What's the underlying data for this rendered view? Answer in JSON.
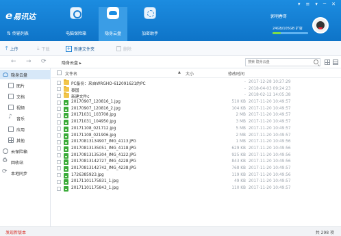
{
  "header": {
    "logo_mark": "e",
    "logo_text": "易讯达",
    "transfer_list": "传输列表",
    "tabs": [
      {
        "label": "电脑保险箱",
        "icon": "safebox-icon"
      },
      {
        "label": "隐身云盘",
        "icon": "cloud-disk-icon",
        "active": true
      },
      {
        "label": "加密助手",
        "icon": "encrypt-helper-icon"
      }
    ],
    "username": "郭明春哥",
    "storage_text": "24GB/105GB",
    "storage_used_fraction": 0.23,
    "expand_label": "扩容",
    "window_controls": [
      "▾",
      "≡",
      "▾",
      "─",
      "✕"
    ]
  },
  "toolbar": {
    "upload": "上传",
    "download": "下载",
    "new_folder": "新建文件夹",
    "delete": "删除"
  },
  "address_bar": {
    "path": "隐身云盘 ▸",
    "search_placeholder": "搜索 隐身云盘"
  },
  "sidebar": {
    "cloud_disk": "隐身云盘",
    "items": [
      {
        "label": "图片",
        "icon": "image-icon"
      },
      {
        "label": "文档",
        "icon": "document-icon"
      },
      {
        "label": "视频",
        "icon": "video-icon"
      },
      {
        "label": "音乐",
        "icon": "music-icon"
      },
      {
        "label": "应用",
        "icon": "app-icon"
      },
      {
        "label": "其他",
        "icon": "other-icon"
      }
    ],
    "bottom_items": [
      {
        "label": "云保险箱",
        "icon": "cloud-safe-icon"
      },
      {
        "label": "回收站",
        "icon": "recycle-bin-icon"
      },
      {
        "label": "本地同步",
        "icon": "local-sync-icon"
      }
    ]
  },
  "list_header": {
    "name": "文件名",
    "sort_arrow": "▲",
    "size": "大小",
    "mtime": "修改时间"
  },
  "files": [
    {
      "type": "folder",
      "name": "PC备份：来自WRGHO-612091621的PC",
      "size": "-",
      "date": "2017-12-28 10:27:29"
    },
    {
      "type": "folder",
      "name": "泰国",
      "size": "-",
      "date": "2018-04-03 09:24:23"
    },
    {
      "type": "folder",
      "name": "新建文件c",
      "size": "-",
      "date": "2018-02-12 14:05:38"
    },
    {
      "type": "image",
      "name": "20170907_120816_1.jpg",
      "size": "510 KB",
      "date": "2017-11-20 10:49:57"
    },
    {
      "type": "image",
      "name": "20170907_120816_2.jpg",
      "size": "104 KB",
      "date": "2017-11-20 10:49:57"
    },
    {
      "type": "image",
      "name": "20171031_103708.jpg",
      "size": "2 MB",
      "date": "2017-11-20 10:49:57"
    },
    {
      "type": "image",
      "name": "20171031_104950.jpg",
      "size": "3 MB",
      "date": "2017-11-20 10:49:57"
    },
    {
      "type": "image",
      "name": "20171108_021712.jpg",
      "size": "5 MB",
      "date": "2017-11-20 10:49:57"
    },
    {
      "type": "image",
      "name": "20171108_021906.jpg",
      "size": "2 MB",
      "date": "2017-11-20 10:49:57"
    },
    {
      "type": "image",
      "name": "20170813134907_IMG_4113.JPG",
      "size": "1 MB",
      "date": "2017-11-20 10:49:56"
    },
    {
      "type": "image",
      "name": "20170813135051_IMG_4118.JPG",
      "size": "629 KB",
      "date": "2017-11-20 10:49:56"
    },
    {
      "type": "image",
      "name": "20170813135304_IMG_4122.JPG",
      "size": "925 KB",
      "date": "2017-11-20 10:49:56"
    },
    {
      "type": "image",
      "name": "20170813142727_IMG_4228.JPG",
      "size": "843 KB",
      "date": "2017-11-20 10:49:56"
    },
    {
      "type": "image",
      "name": "20170813142742_IMG_4238.JPG",
      "size": "768 KB",
      "date": "2017-11-20 10:49:57"
    },
    {
      "type": "image",
      "name": "1726385923.jpg",
      "size": "119 KB",
      "date": "2017-11-20 10:49:56"
    },
    {
      "type": "image",
      "name": "20171101175831_1.jpg",
      "size": "49 KB",
      "date": "2017-11-20 10:49:57"
    },
    {
      "type": "image",
      "name": "20171101175843_1.jpg",
      "size": "110 KB",
      "date": "2017-11-20 10:49:57"
    }
  ],
  "status": {
    "new_version": "发现新版本",
    "count": "共 298 项"
  },
  "colors": {
    "header_blue": "#0e74c8",
    "accent": "#1a7fd3",
    "folder": "#f2c54a",
    "image_file": "#3bab3a",
    "alert_red": "#d6342c"
  }
}
